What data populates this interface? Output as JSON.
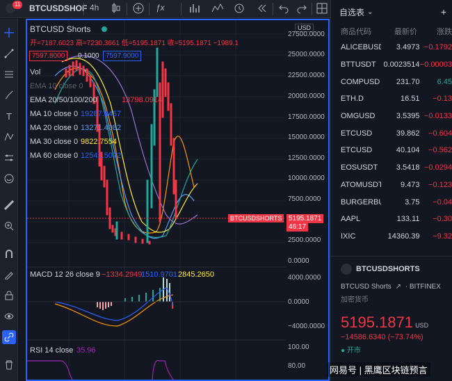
{
  "topbar": {
    "badge_count": "11",
    "symbol": "BTCUSDSHOF",
    "interval": "4h"
  },
  "legend": {
    "title": "BTCUSD Shorts",
    "ohlc": "开=7187.6023 高=7230.3661 低=5195.1871 收=5195.1871 −1989.1",
    "sell_price": "7597.8000",
    "spread": "0.1000",
    "buy_price": "7597.9000",
    "vol": "Vol",
    "ema_top": "EMA 10 close 0",
    "ema_line": "EMA 20/50/100/200",
    "ema_value": "13798.0914",
    "ma10": "MA 10 close 0",
    "ma10_val": "19287.0457",
    "ma20": "MA 20 close 0",
    "ma20_val": "13271.4082",
    "ma30": "MA 30 close 0",
    "ma30_val": "9822.7554",
    "ma60": "MA 60 close 0",
    "ma60_val": "12541.5072",
    "macd": "MACD 12 26 close 9",
    "macd_v1": "−1334.2949",
    "macd_v2": "1510.9701",
    "macd_v3": "2845.2650",
    "rsi": "RSI 14 close",
    "rsi_val": "35.96"
  },
  "axis": {
    "currency": "USD",
    "ticks": [
      "27500.0000",
      "25000.0000",
      "22500.0000",
      "20000.0000",
      "17500.0000",
      "15000.0000",
      "12500.0000",
      "10000.0000",
      "7500.0000",
      "5000.0000",
      "2500.0000",
      "0.0000"
    ],
    "price_label": "BTCUSDSHORTS",
    "price_value": "5195.1871",
    "countdown": "46:17",
    "macd_ticks": [
      "4000.0000",
      "0.0000",
      "−4000.0000"
    ],
    "rsi_ticks": [
      "100.00",
      "80.00"
    ]
  },
  "watchlist": {
    "title": "自选表",
    "col_symbol": "商品代码",
    "col_last": "最新价",
    "col_change": "涨跌",
    "rows": [
      {
        "sym": "ALICEBUSD",
        "last": "3.4973",
        "chg": "−0.1792",
        "up": false
      },
      {
        "sym": "BTTUSDT",
        "last": "0.0023514",
        "chg": "−0.00003",
        "up": false
      },
      {
        "sym": "COMPUSD",
        "last": "231.70",
        "chg": "6.45",
        "up": true
      },
      {
        "sym": "ETH.D",
        "last": "16.51",
        "chg": "−0.13",
        "up": false
      },
      {
        "sym": "OMGUSD",
        "last": "3.5395",
        "chg": "−0.0133",
        "up": false
      },
      {
        "sym": "ETCUSD",
        "last": "39.862",
        "chg": "−0.604",
        "up": false
      },
      {
        "sym": "ETCUSD",
        "last": "40.104",
        "chg": "−0.562",
        "up": false
      },
      {
        "sym": "EOSUSDT",
        "last": "3.5418",
        "chg": "−0.0294",
        "up": false
      },
      {
        "sym": "ATOMUSDT",
        "last": "9.473",
        "chg": "−0.123",
        "up": false
      },
      {
        "sym": "BURGERBU",
        "last": "3.75",
        "chg": "−0.04",
        "up": false
      },
      {
        "sym": "AAPL",
        "last": "133.11",
        "chg": "−0.30",
        "up": false
      },
      {
        "sym": "IXIC",
        "last": "14360.39",
        "chg": "−9.32",
        "up": false
      }
    ]
  },
  "details": {
    "symbol": "BTCUSDSHORTS",
    "name": "BTCUSD Shorts",
    "exchange": "BITFINEX",
    "category": "加密货币",
    "price": "5195.1871",
    "currency": "USD",
    "change": "−14586.6340 (−73.74%)",
    "status": "开市"
  },
  "watermark": "网易号 | 黑鹰区块链预言"
}
